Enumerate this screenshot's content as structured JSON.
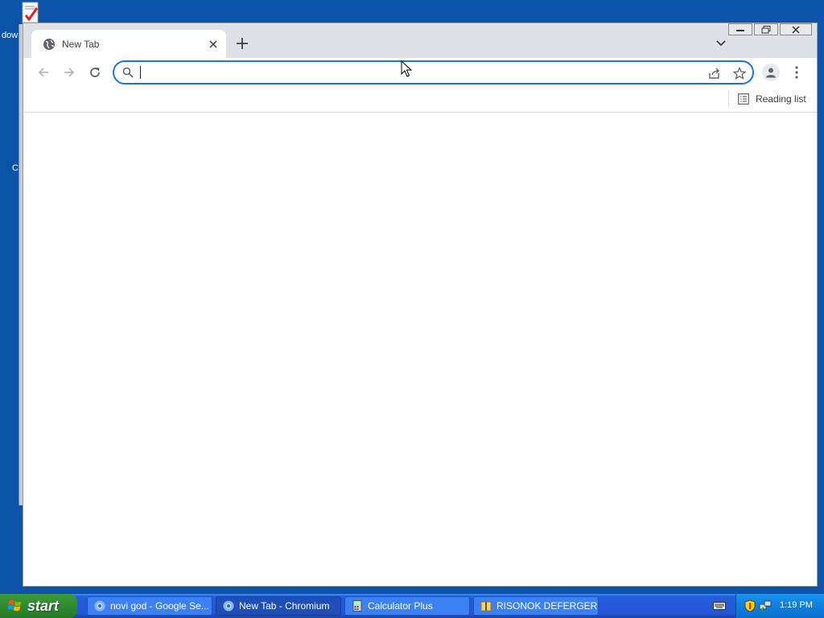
{
  "desktop": {
    "icon_label_1": "dow",
    "icon_label_2": "C"
  },
  "browser": {
    "tab": {
      "title": "New Tab"
    },
    "omnibox": {
      "value": "",
      "placeholder": ""
    },
    "bookmarks_bar": {
      "reading_list_label": "Reading list"
    }
  },
  "taskbar": {
    "start_label": "start",
    "buttons": [
      {
        "label": "novi god - Google Se..."
      },
      {
        "label": "New Tab - Chromium"
      },
      {
        "label": "Calculator Plus"
      },
      {
        "label": "RISONOK DEFERGER"
      }
    ],
    "clock": "1:19 PM"
  },
  "colors": {
    "accent": "#1a73e8",
    "desktop": "#0b52a8",
    "taskbar": "#245edb",
    "start": "#2f8a2f"
  }
}
